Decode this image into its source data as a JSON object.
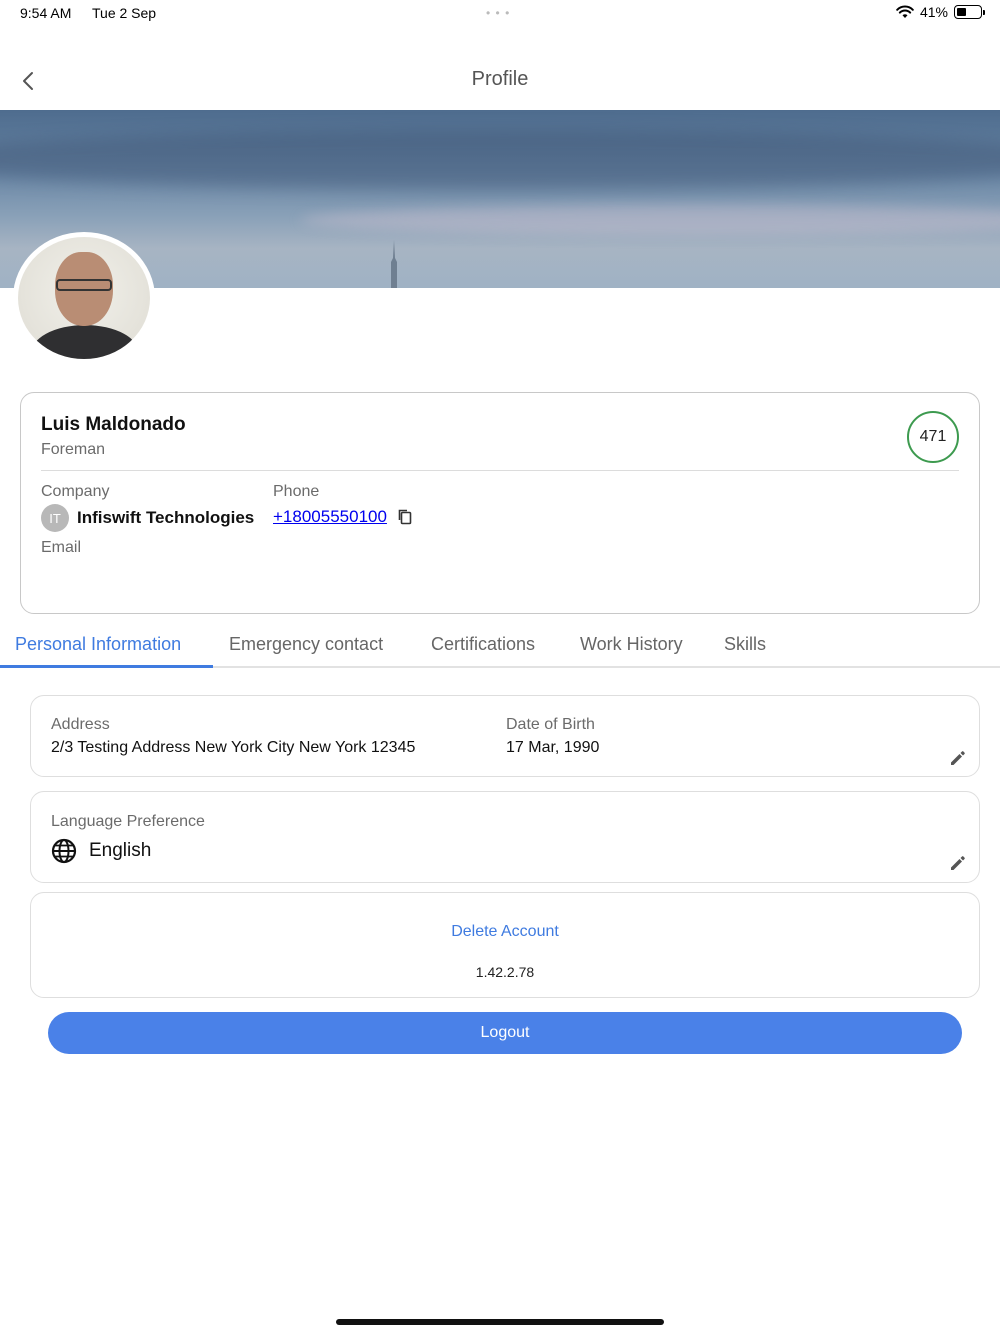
{
  "status_bar": {
    "time": "9:54 AM",
    "date": "Tue 2 Sep",
    "dots": "• • •",
    "battery_percent": "41%",
    "battery_level": 0.41,
    "icons": [
      "wifi-icon",
      "battery-icon"
    ]
  },
  "header": {
    "title": "Profile",
    "back_icon": "chevron-left-icon"
  },
  "profile": {
    "name": "Luis Maldonado",
    "role": "Foreman",
    "score": "471",
    "company_label": "Company",
    "company_initials": "IT",
    "company_name": "Infiswift Technologies",
    "phone_label": "Phone",
    "phone": "+18005550100",
    "email_label": "Email",
    "copy_icon": "copy-icon"
  },
  "tabs": [
    {
      "label": "Personal Information",
      "active": true
    },
    {
      "label": "Emergency contact",
      "active": false
    },
    {
      "label": "Certifications",
      "active": false
    },
    {
      "label": "Work History",
      "active": false
    },
    {
      "label": "Skills",
      "active": false
    }
  ],
  "personal_info": {
    "address_label": "Address",
    "address": "2/3 Testing Address New York City New York 12345",
    "dob_label": "Date of Birth",
    "dob": "17 Mar, 1990",
    "language_label": "Language Preference",
    "language": "English",
    "language_icon": "globe-icon",
    "edit_icon": "pencil-icon"
  },
  "account": {
    "delete_label": "Delete Account",
    "version": "1.42.2.78"
  },
  "logout_label": "Logout",
  "colors": {
    "accent": "#3f7be0",
    "logout_button": "#4a81e8",
    "score_ring": "#3d9a4f",
    "link": "#0000ee"
  }
}
